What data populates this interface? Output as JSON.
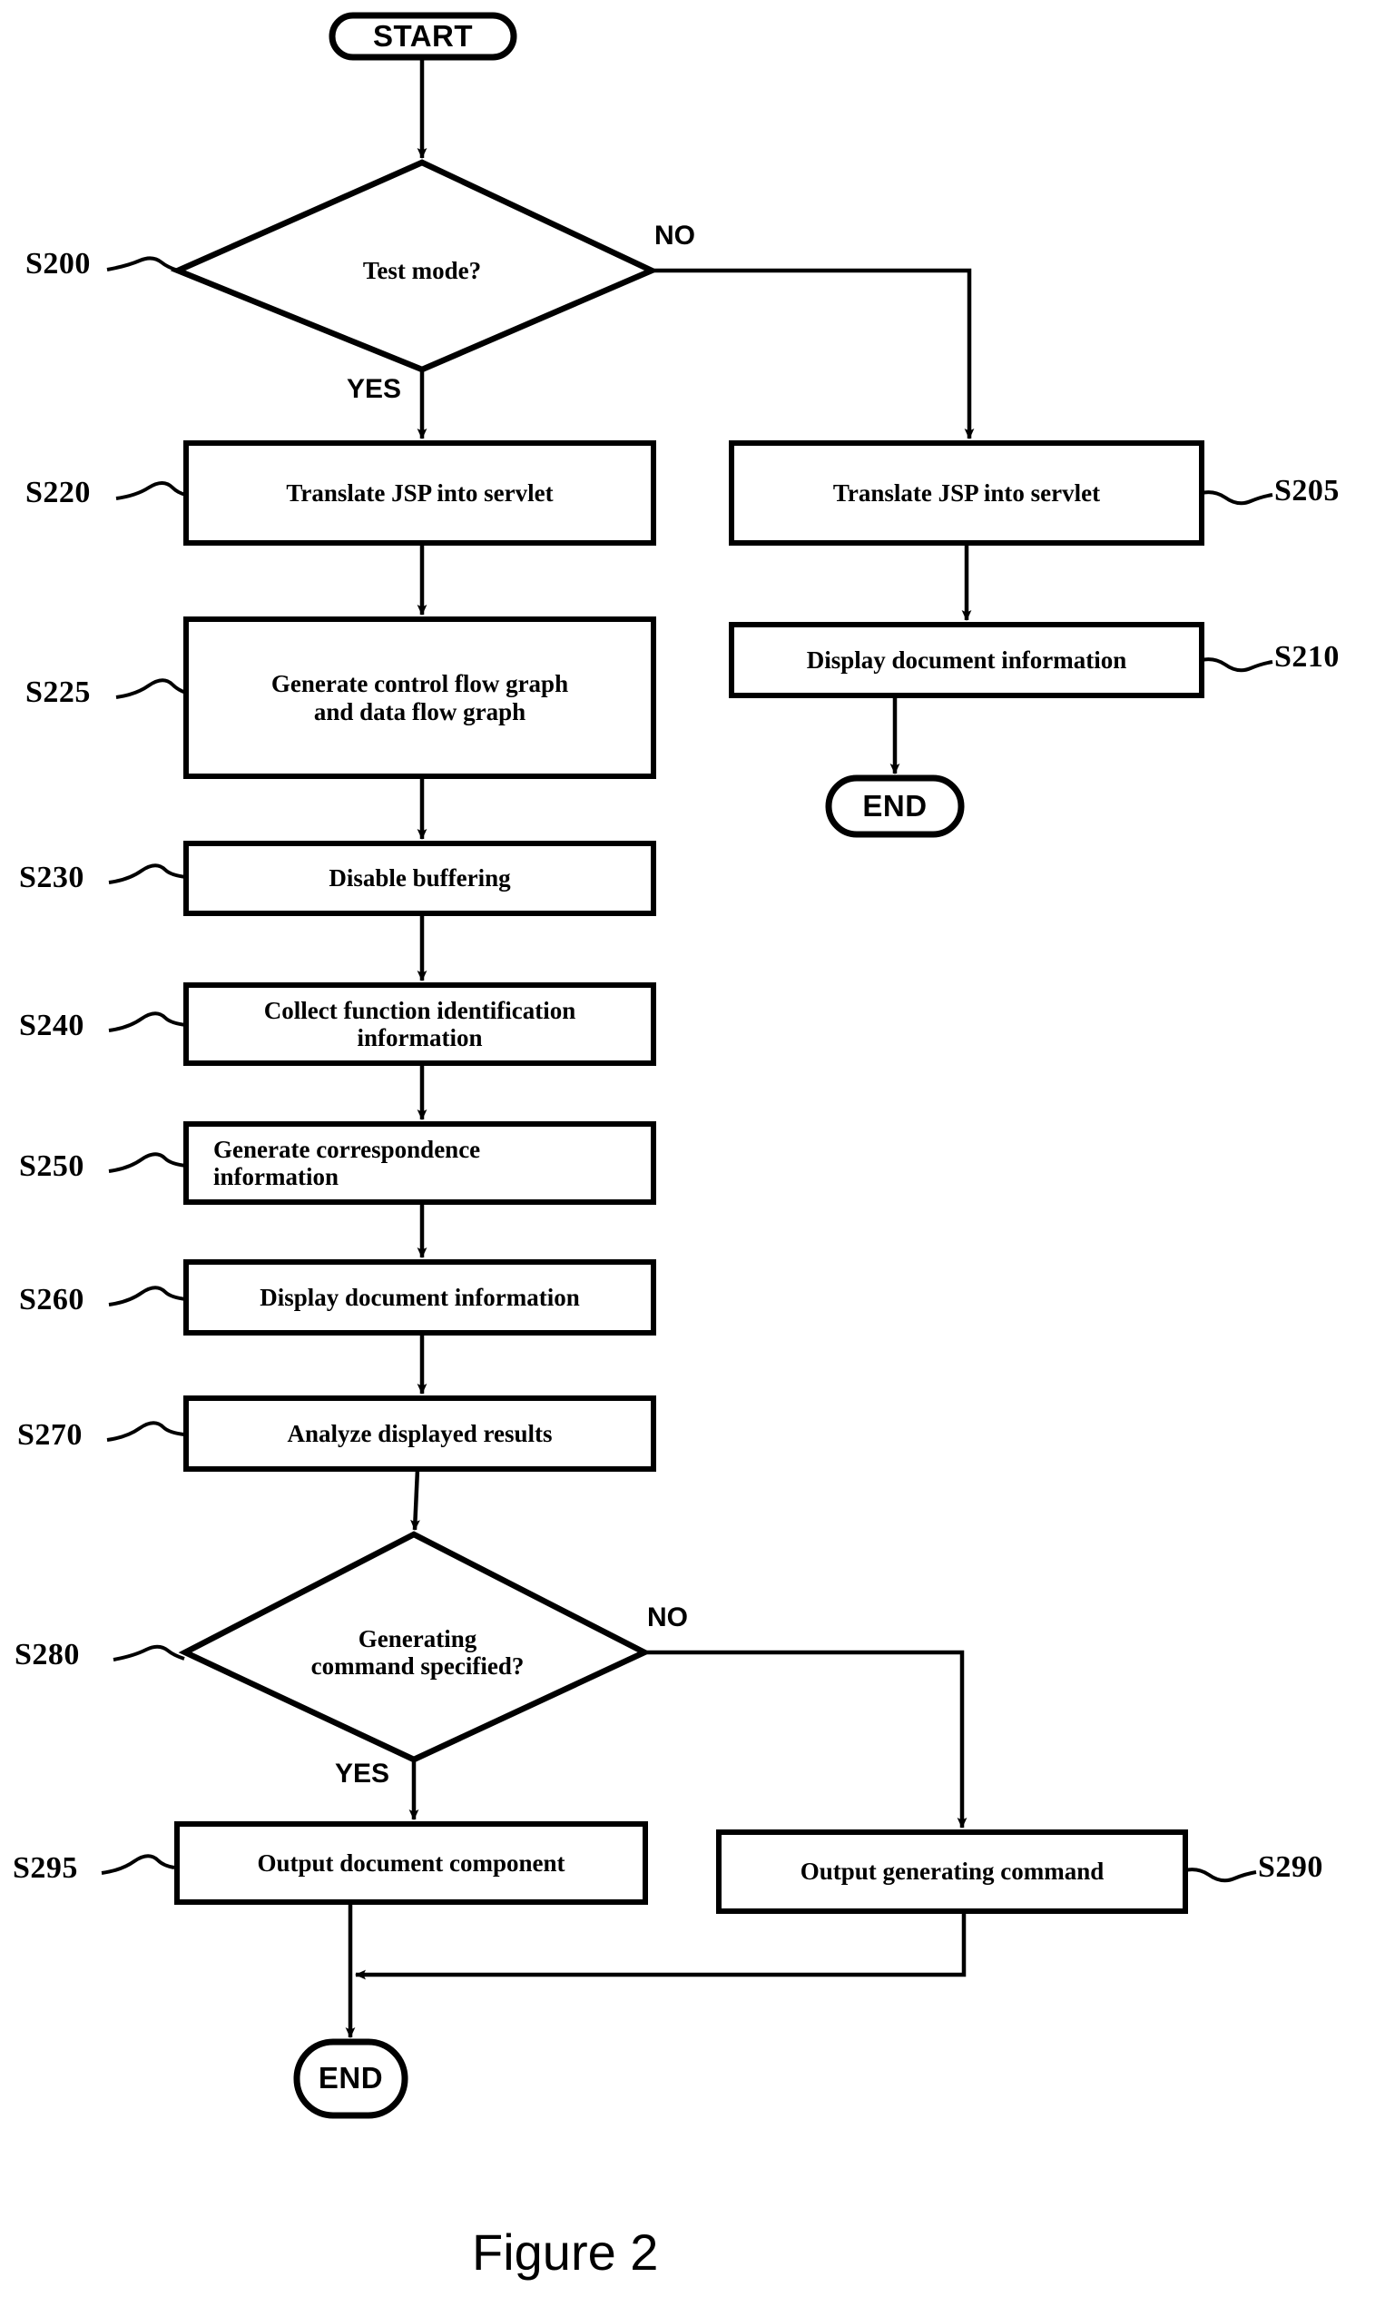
{
  "figure": {
    "caption": "Figure 2"
  },
  "colors": {
    "stroke": "#000000",
    "fill": "#ffffff",
    "background": "#ffffff"
  },
  "chart_data": {
    "type": "diagram",
    "diagram_kind": "flowchart",
    "title": "Figure 2",
    "nodes": [
      {
        "id": "start",
        "shape": "terminator",
        "text": "START",
        "tag": ""
      },
      {
        "id": "s200",
        "shape": "decision",
        "text": "Test mode?",
        "tag": "S200"
      },
      {
        "id": "s220",
        "shape": "process",
        "text": "Translate JSP into servlet",
        "tag": "S220"
      },
      {
        "id": "s225",
        "shape": "process",
        "text": "Generate control flow graph and data flow graph",
        "tag": "S225"
      },
      {
        "id": "s230",
        "shape": "process",
        "text": "Disable buffering",
        "tag": "S230"
      },
      {
        "id": "s240",
        "shape": "process",
        "text": "Collect function identification information",
        "tag": "S240"
      },
      {
        "id": "s250",
        "shape": "process",
        "text": "Generate correspondence information",
        "tag": "S250"
      },
      {
        "id": "s260",
        "shape": "process",
        "text": "Display document information",
        "tag": "S260"
      },
      {
        "id": "s270",
        "shape": "process",
        "text": "Analyze displayed results",
        "tag": "S270"
      },
      {
        "id": "s280",
        "shape": "decision",
        "text": "Generating command specified?",
        "tag": "S280"
      },
      {
        "id": "s295",
        "shape": "process",
        "text": "Output document component",
        "tag": "S295"
      },
      {
        "id": "s290",
        "shape": "process",
        "text": "Output generating command",
        "tag": "S290"
      },
      {
        "id": "end_l",
        "shape": "terminator",
        "text": "END",
        "tag": ""
      },
      {
        "id": "s205",
        "shape": "process",
        "text": "Translate JSP into servlet",
        "tag": "S205"
      },
      {
        "id": "s210",
        "shape": "process",
        "text": "Display document information",
        "tag": "S210"
      },
      {
        "id": "end_r",
        "shape": "terminator",
        "text": "END",
        "tag": ""
      }
    ],
    "edges": [
      {
        "from": "start",
        "to": "s200",
        "label": ""
      },
      {
        "from": "s200",
        "to": "s220",
        "label": "YES"
      },
      {
        "from": "s200",
        "to": "s205",
        "label": "NO"
      },
      {
        "from": "s220",
        "to": "s225",
        "label": ""
      },
      {
        "from": "s225",
        "to": "s230",
        "label": ""
      },
      {
        "from": "s230",
        "to": "s240",
        "label": ""
      },
      {
        "from": "s240",
        "to": "s250",
        "label": ""
      },
      {
        "from": "s250",
        "to": "s260",
        "label": ""
      },
      {
        "from": "s260",
        "to": "s270",
        "label": ""
      },
      {
        "from": "s270",
        "to": "s280",
        "label": ""
      },
      {
        "from": "s280",
        "to": "s295",
        "label": "YES"
      },
      {
        "from": "s280",
        "to": "s290",
        "label": "NO"
      },
      {
        "from": "s295",
        "to": "end_l",
        "label": ""
      },
      {
        "from": "s290",
        "to": "end_l",
        "label": ""
      },
      {
        "from": "s205",
        "to": "s210",
        "label": ""
      },
      {
        "from": "s210",
        "to": "end_r",
        "label": ""
      }
    ]
  },
  "nodes": {
    "start": {
      "text": "START"
    },
    "s200": {
      "text": "Test mode?",
      "tag": "S200"
    },
    "s220": {
      "text": "Translate JSP into servlet",
      "tag": "S220"
    },
    "s225": {
      "line1": "Generate control flow graph",
      "line2": "and data flow graph",
      "tag": "S225"
    },
    "s230": {
      "text": "Disable buffering",
      "tag": "S230"
    },
    "s240": {
      "line1": "Collect function identification",
      "line2": "information",
      "tag": "S240"
    },
    "s250": {
      "line1": "Generate correspondence",
      "line2": "information",
      "tag": "S250"
    },
    "s260": {
      "text": "Display document information",
      "tag": "S260"
    },
    "s270": {
      "text": "Analyze displayed results",
      "tag": "S270"
    },
    "s280": {
      "line1": "Generating",
      "line2": "command specified?",
      "tag": "S280"
    },
    "s295": {
      "text": "Output document component",
      "tag": "S295"
    },
    "s290": {
      "text": "Output generating command",
      "tag": "S290"
    },
    "end_left": {
      "text": "END"
    },
    "s205": {
      "text": "Translate JSP into servlet",
      "tag": "S205"
    },
    "s210": {
      "text": "Display document information",
      "tag": "S210"
    },
    "end_right": {
      "text": "END"
    }
  },
  "branch_labels": {
    "s200_no": "NO",
    "s200_yes": "YES",
    "s280_no": "NO",
    "s280_yes": "YES"
  }
}
